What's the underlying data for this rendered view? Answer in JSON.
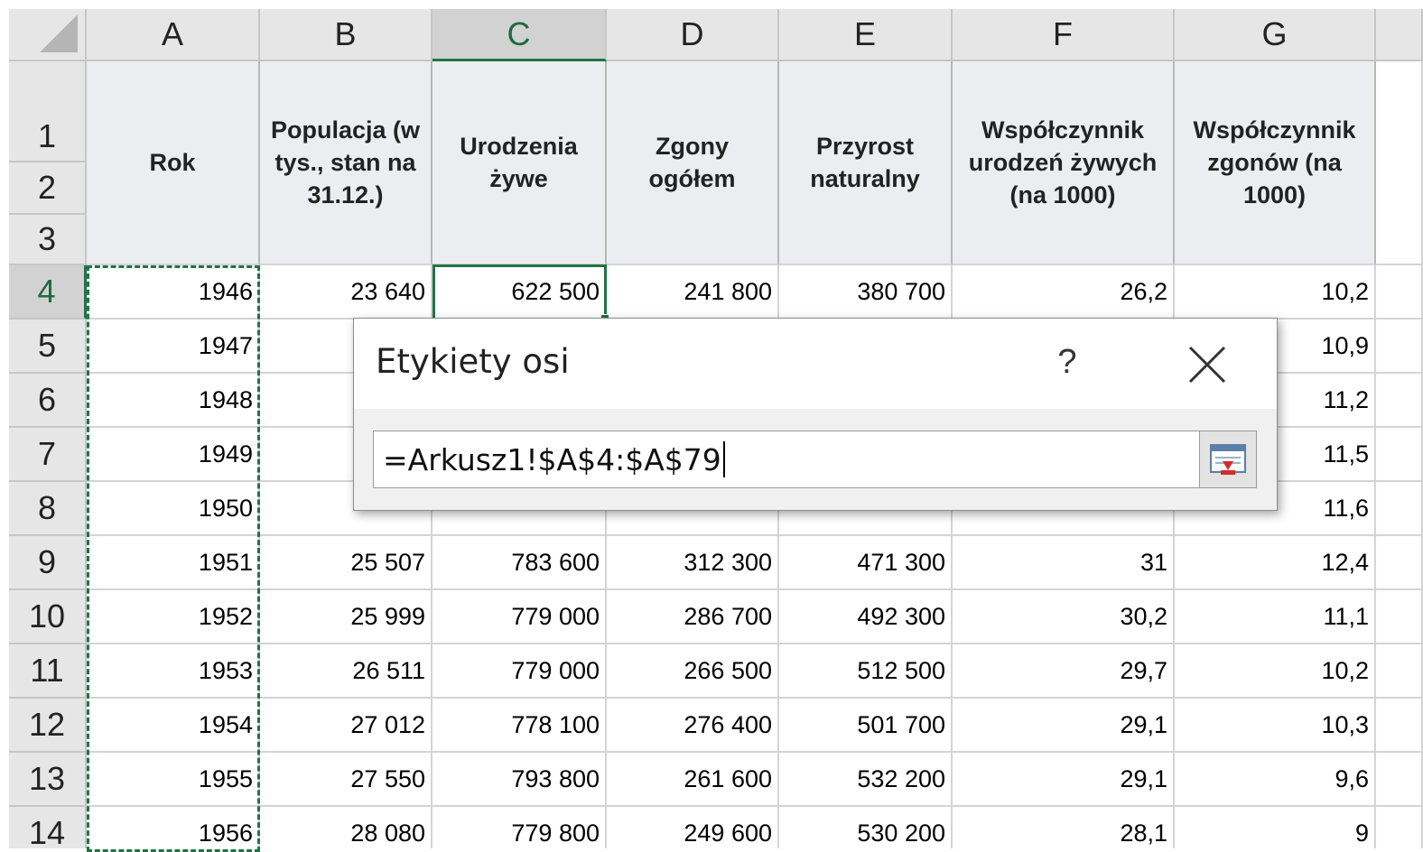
{
  "columns": [
    "A",
    "B",
    "C",
    "D",
    "E",
    "F",
    "G"
  ],
  "header_rows": [
    "1",
    "2",
    "3"
  ],
  "headers": [
    "Rok",
    "Populacja (w tys., stan na 31.12.)",
    "Urodzenia żywe",
    "Zgony ogółem",
    "Przyrost naturalny",
    "Współczynnik urodzeń żywych (na 1000)",
    "Współczynnik zgonów (na 1000)"
  ],
  "rows": [
    {
      "num": "4",
      "cells": [
        "1946",
        "23 640",
        "622 500",
        "241 800",
        "380 700",
        "26,2",
        "10,2"
      ]
    },
    {
      "num": "5",
      "cells": [
        "1947",
        "",
        "",
        "",
        "",
        "",
        "10,9"
      ]
    },
    {
      "num": "6",
      "cells": [
        "1948",
        "",
        "",
        "",
        "",
        "",
        "11,2"
      ]
    },
    {
      "num": "7",
      "cells": [
        "1949",
        "",
        "",
        "",
        "",
        "",
        "11,5"
      ]
    },
    {
      "num": "8",
      "cells": [
        "1950",
        "",
        "",
        "",
        "",
        "",
        "11,6"
      ]
    },
    {
      "num": "9",
      "cells": [
        "1951",
        "25 507",
        "783 600",
        "312 300",
        "471 300",
        "31",
        "12,4"
      ]
    },
    {
      "num": "10",
      "cells": [
        "1952",
        "25 999",
        "779 000",
        "286 700",
        "492 300",
        "30,2",
        "11,1"
      ]
    },
    {
      "num": "11",
      "cells": [
        "1953",
        "26 511",
        "779 000",
        "266 500",
        "512 500",
        "29,7",
        "10,2"
      ]
    },
    {
      "num": "12",
      "cells": [
        "1954",
        "27 012",
        "778 100",
        "276 400",
        "501 700",
        "29,1",
        "10,3"
      ]
    },
    {
      "num": "13",
      "cells": [
        "1955",
        "27 550",
        "793 800",
        "261 600",
        "532 200",
        "29,1",
        "9,6"
      ]
    },
    {
      "num": "14",
      "cells": [
        "1956",
        "28 080",
        "779 800",
        "249 600",
        "530 200",
        "28,1",
        "9"
      ]
    }
  ],
  "dialog": {
    "title": "Etykiety osi",
    "help": "?",
    "range_value": "=Arkusz1!$A$4:$A$79"
  },
  "colors": {
    "selection": "#217346",
    "header_bg": "#e6e6e6"
  }
}
